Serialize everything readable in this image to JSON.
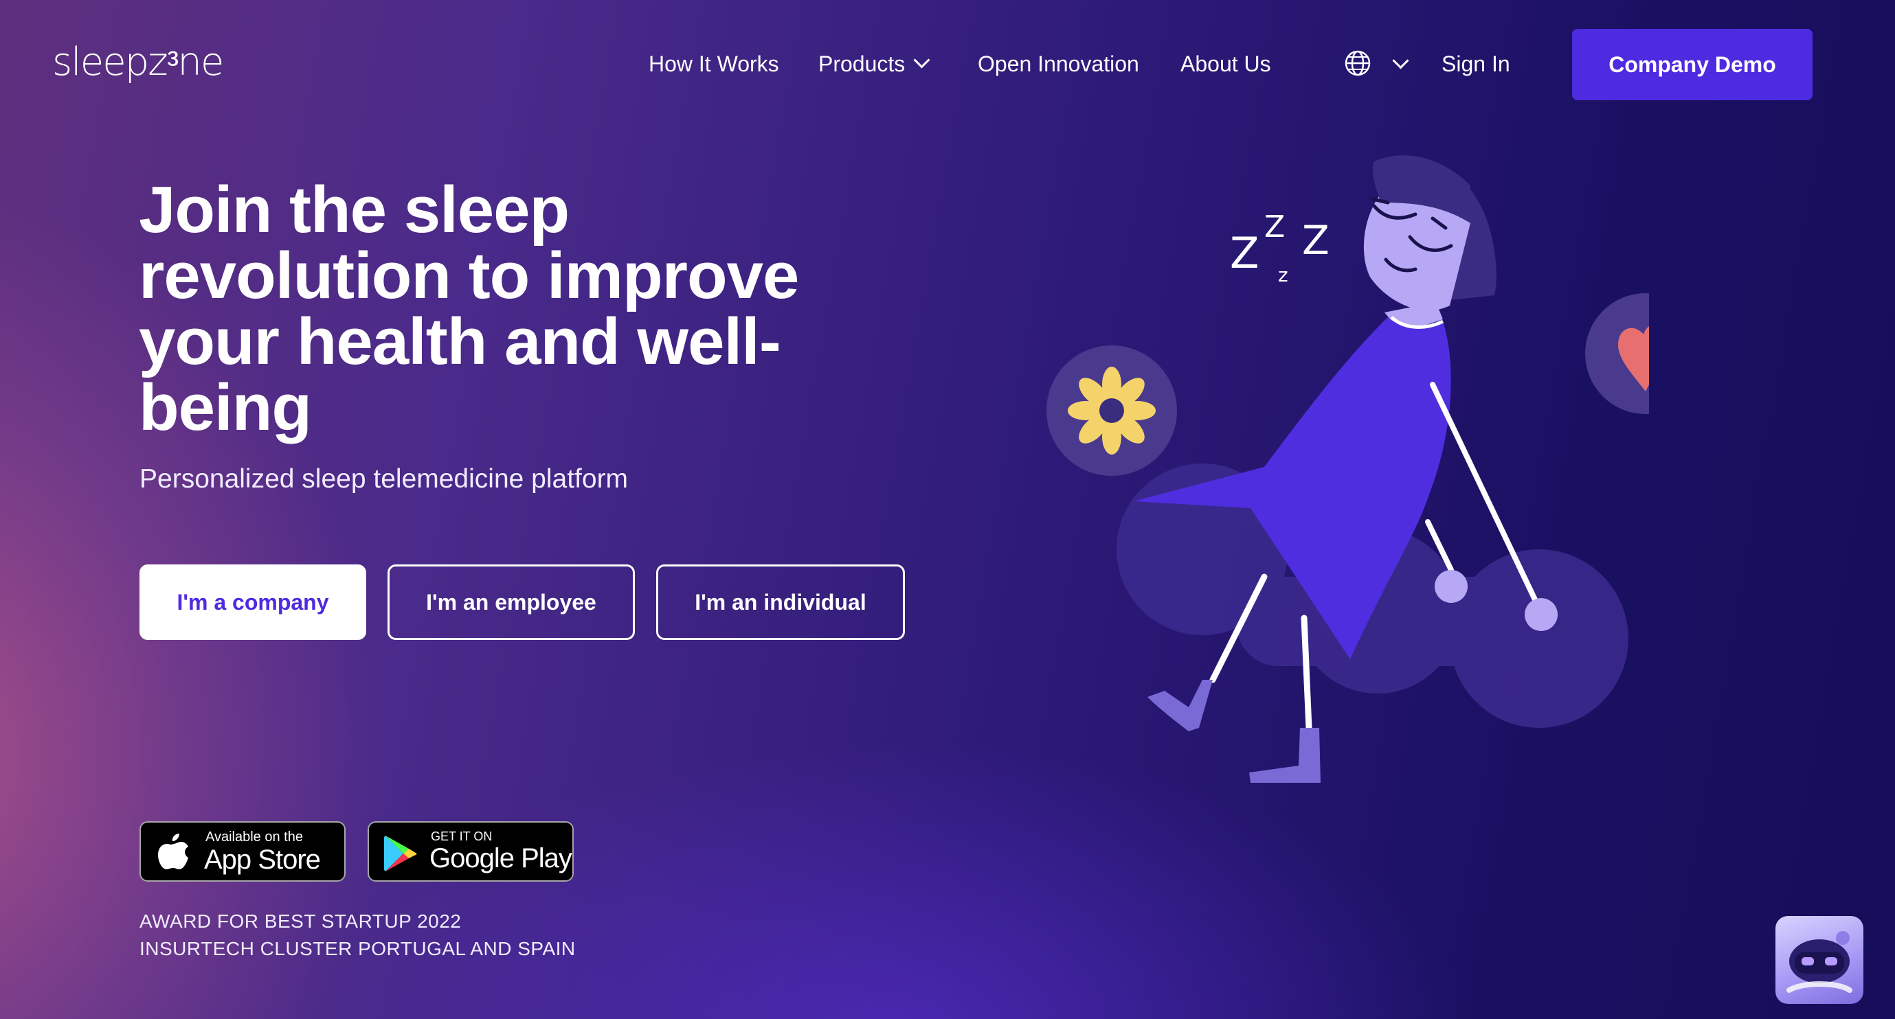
{
  "header": {
    "logo_text": "sleepzᵌne",
    "nav": [
      {
        "label": "How It Works"
      },
      {
        "label": "Products"
      },
      {
        "label": "Open Innovation"
      },
      {
        "label": "About Us"
      }
    ],
    "language_icon": "globe-icon",
    "sign_in": "Sign In",
    "demo_button": "Company Demo"
  },
  "hero": {
    "headline": "Join the sleep revolution to improve your health and well-being",
    "subtitle": "Personalized sleep telemedicine platform",
    "ctas": [
      {
        "label": "I'm a company"
      },
      {
        "label": "I'm an employee"
      },
      {
        "label": "I'm an individual"
      }
    ]
  },
  "stores": {
    "apple": {
      "small": "Available on the",
      "big": "App Store"
    },
    "google": {
      "small": "GET IT ON",
      "big": "Google Play"
    }
  },
  "award": {
    "line1": "AWARD FOR BEST STARTUP 2022",
    "line2": "INSURTECH CLUSTER PORTUGAL AND SPAIN"
  },
  "illustration": {
    "zzz": [
      "Z",
      "Z",
      "Z",
      "z"
    ]
  },
  "colors": {
    "accent": "#4e2ae0",
    "flower": "#f5d36b",
    "heart": "#e76f6f",
    "illustration_purple": "#4f2ee0",
    "skin": "#b7a8f5"
  }
}
